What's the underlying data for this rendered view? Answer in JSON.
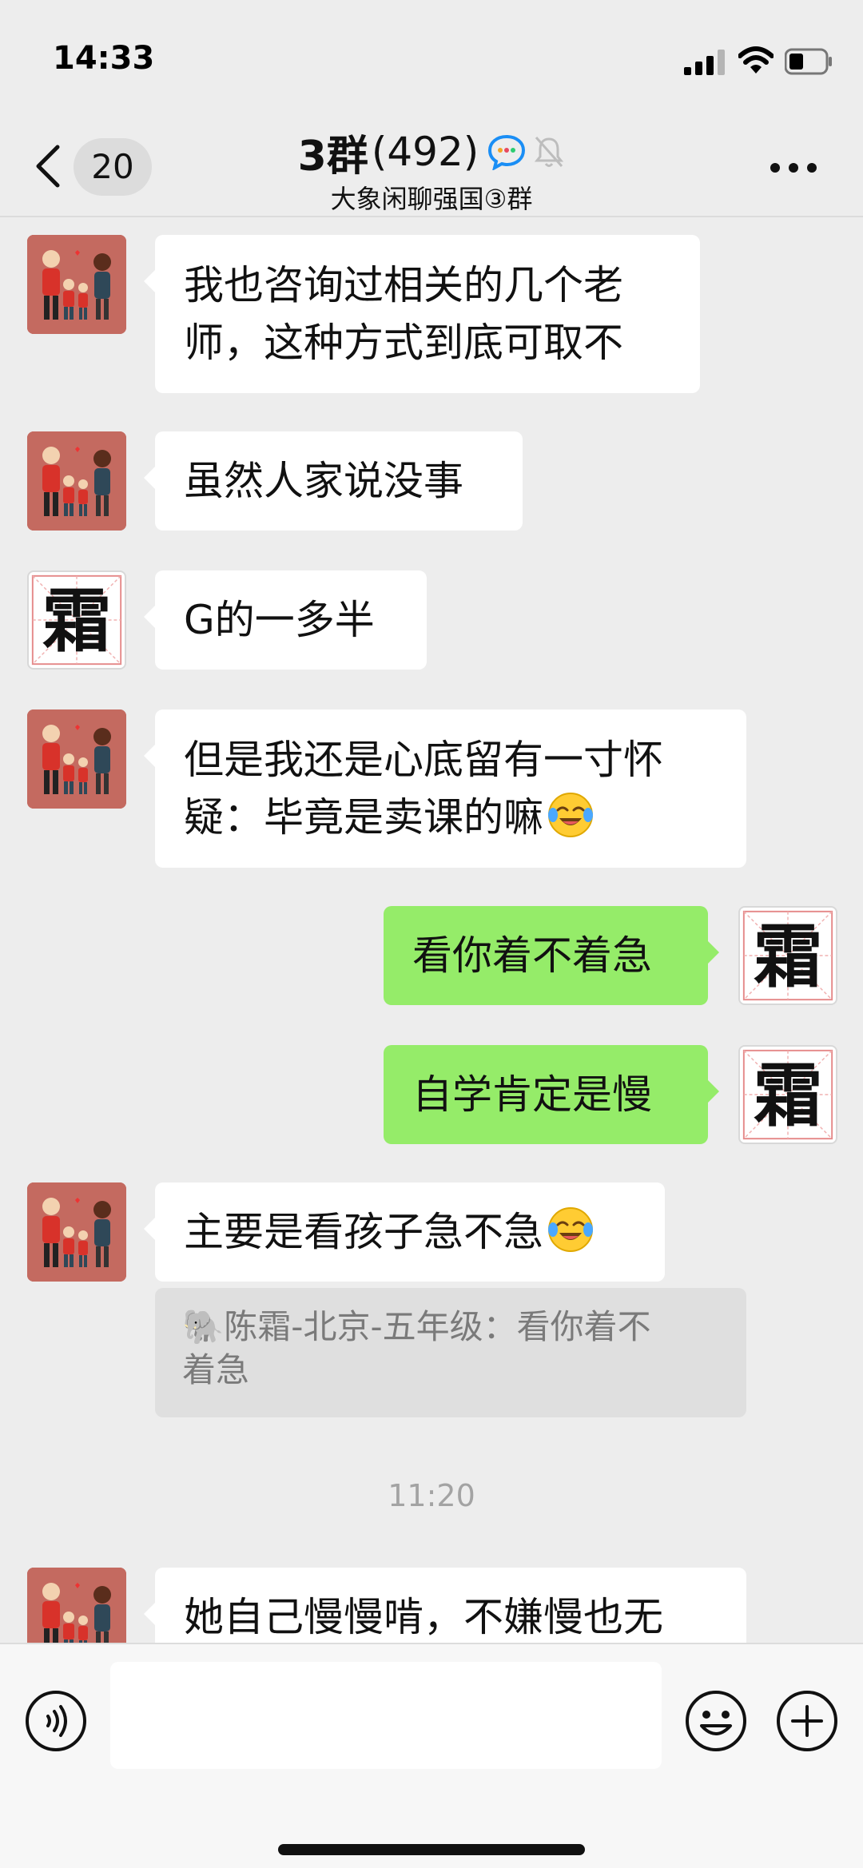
{
  "status_bar": {
    "time": "14:33",
    "signal_icon": "cellular-signal-icon",
    "wifi_icon": "wifi-icon",
    "battery_icon": "battery-icon",
    "battery_level": 0.4
  },
  "nav": {
    "back_icon": "chevron-left-icon",
    "unread_count": "20",
    "title": "3群",
    "member_count": "(492)",
    "title_icon": "chat-bubble-brand-icon",
    "mute_icon": "bell-muted-icon",
    "subtitle": "大象闲聊强国③群",
    "more_icon": "more-dots-icon"
  },
  "messages": [
    {
      "side": "in",
      "sender": "family-avatar",
      "lines": [
        "我也咨询过相关的几个老",
        "师，这种方式到底可取不"
      ]
    },
    {
      "side": "in",
      "sender": "family-avatar",
      "lines": [
        "虽然人家说没事"
      ]
    },
    {
      "side": "in",
      "sender": "frost-avatar",
      "lines": [
        "G的一多半"
      ]
    },
    {
      "side": "in",
      "sender": "family-avatar",
      "lines": [
        "但是我还是心底留有一寸怀",
        "疑：毕竟是卖课的嘛"
      ],
      "emoji": "tears-of-joy-emoji"
    },
    {
      "side": "out",
      "sender": "frost-avatar",
      "lines": [
        "看你着不着急"
      ]
    },
    {
      "side": "out",
      "sender": "frost-avatar",
      "lines": [
        "自学肯定是慢"
      ]
    },
    {
      "side": "in",
      "sender": "family-avatar",
      "lines": [
        "主要是看孩子急不急"
      ],
      "emoji": "tears-of-joy-emoji"
    },
    {
      "side": "in",
      "sender": "family-avatar",
      "lines": [
        "她自己慢慢啃，不嫌慢也无"
      ]
    }
  ],
  "avatars": {
    "frost_glyph": "霜"
  },
  "quote": {
    "icon": "elephant-emoji",
    "elephant": "🐘",
    "line1": "陈霜-北京-五年级：看你着不",
    "line2": "着急"
  },
  "time_separator": "11:20",
  "input_bar": {
    "voice_icon": "voice-input-icon",
    "emoji_icon": "smiley-face-icon",
    "add_icon": "plus-circle-icon",
    "input_value": ""
  },
  "colors": {
    "background": "#ededed",
    "incoming_bubble": "#ffffff",
    "outgoing_bubble": "#95ec69",
    "quote_background": "#dfdfdf",
    "family_avatar": "#b8605a"
  }
}
